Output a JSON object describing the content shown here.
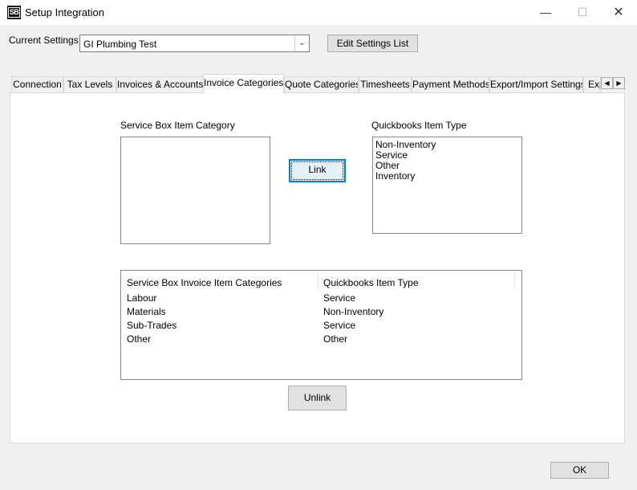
{
  "window": {
    "title": "Setup Integration",
    "app_icon_text": "SB"
  },
  "settings": {
    "label": "Current Settings",
    "current": "GI Plumbing Test",
    "edit_button": "Edit Settings List"
  },
  "tabs": [
    {
      "label": "Connection"
    },
    {
      "label": "Tax Levels"
    },
    {
      "label": "Invoices & Accounts"
    },
    {
      "label": "Invoice Categories",
      "active": true
    },
    {
      "label": "Quote Categories"
    },
    {
      "label": "Timesheets"
    },
    {
      "label": "Payment Methods"
    },
    {
      "label": "Export/Import Settings"
    },
    {
      "label": "Exp"
    }
  ],
  "panel": {
    "sb_category_label": "Service Box Item Category",
    "sb_category_items": [],
    "qb_type_label": "Quickbooks Item Type",
    "qb_type_items": [
      "Non-Inventory",
      "Service",
      "Other",
      "Inventory"
    ],
    "link_button": "Link",
    "unlink_button": "Unlink",
    "grid": {
      "columns": [
        "Service Box Invoice Item Categories",
        "Quickbooks Item Type"
      ],
      "rows": [
        [
          "Labour",
          "Service"
        ],
        [
          "Materials",
          "Non-Inventory"
        ],
        [
          "Sub-Trades",
          "Service"
        ],
        [
          "Other",
          "Other"
        ]
      ]
    }
  },
  "footer": {
    "ok_button": "OK"
  }
}
